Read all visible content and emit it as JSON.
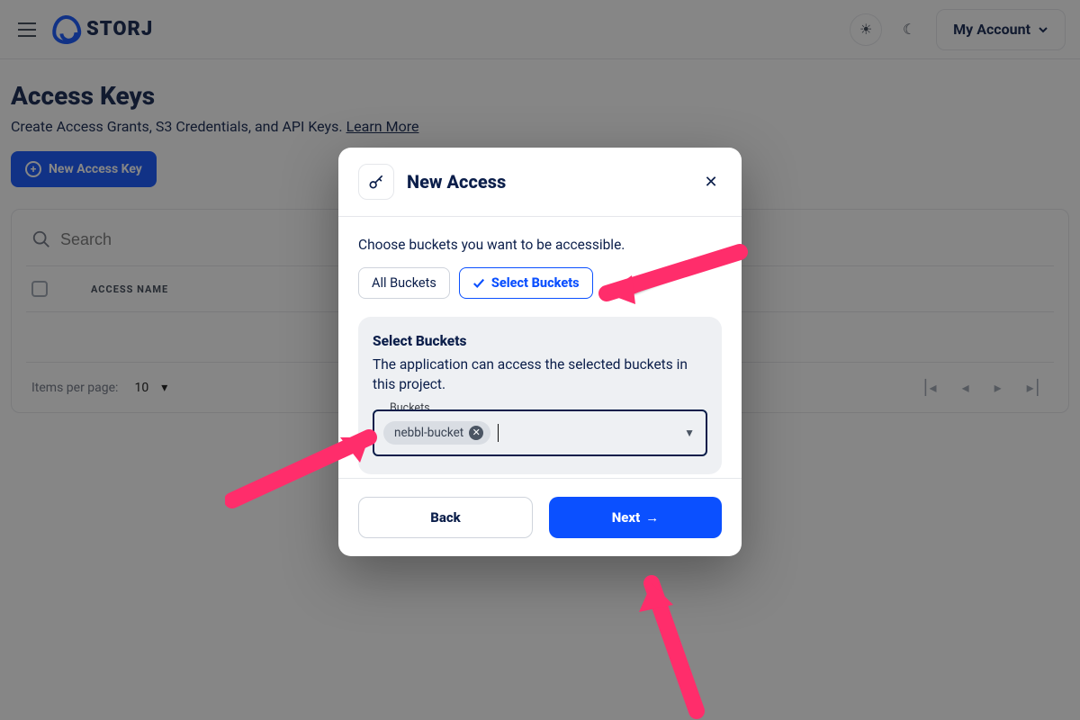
{
  "header": {
    "brand": "STORJ",
    "account_label": "My Account"
  },
  "page": {
    "title": "Access Keys",
    "subtitle_prefix": "Create Access Grants, S3 Credentials, and API Keys. ",
    "learn_more": "Learn More",
    "new_key_label": "New Access Key"
  },
  "table": {
    "search_placeholder": "Search",
    "col_access_name": "ACCESS NAME",
    "items_per_page_label": "Items per page:",
    "items_per_page_value": "10"
  },
  "modal": {
    "title": "New Access",
    "description": "Choose buckets you want to be accessible.",
    "seg_all": "All Buckets",
    "seg_select": "Select Buckets",
    "panel_title": "Select Buckets",
    "panel_desc": "The application can access the selected buckets in this project.",
    "field_label": "Buckets",
    "selected_chip": "nebbl-bucket",
    "back_label": "Back",
    "next_label": "Next"
  }
}
